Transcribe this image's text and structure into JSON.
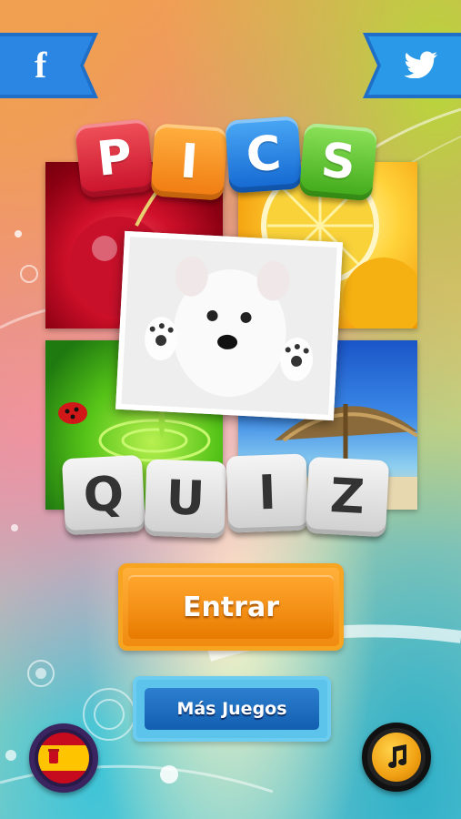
{
  "logo": {
    "top_letters": [
      "P",
      "I",
      "C",
      "S"
    ],
    "bottom_letters": [
      "Q",
      "U",
      "I",
      "Z"
    ]
  },
  "buttons": {
    "enter_label": "Entrar",
    "more_games_label": "Más Juegos"
  },
  "social": {
    "facebook_glyph": "f",
    "icons": [
      "facebook-icon",
      "twitter-icon"
    ]
  },
  "language": {
    "flag": "spain-flag-icon"
  },
  "sound": {
    "icon": "music-note-icon"
  },
  "colors": {
    "tile_p": "#e02838",
    "tile_i": "#f58a20",
    "tile_c": "#2a84e0",
    "tile_s": "#5cc428",
    "button_orange": "#f49016",
    "button_blue": "#1e6fc2",
    "ribbon_blue": "#2a8fe0"
  }
}
